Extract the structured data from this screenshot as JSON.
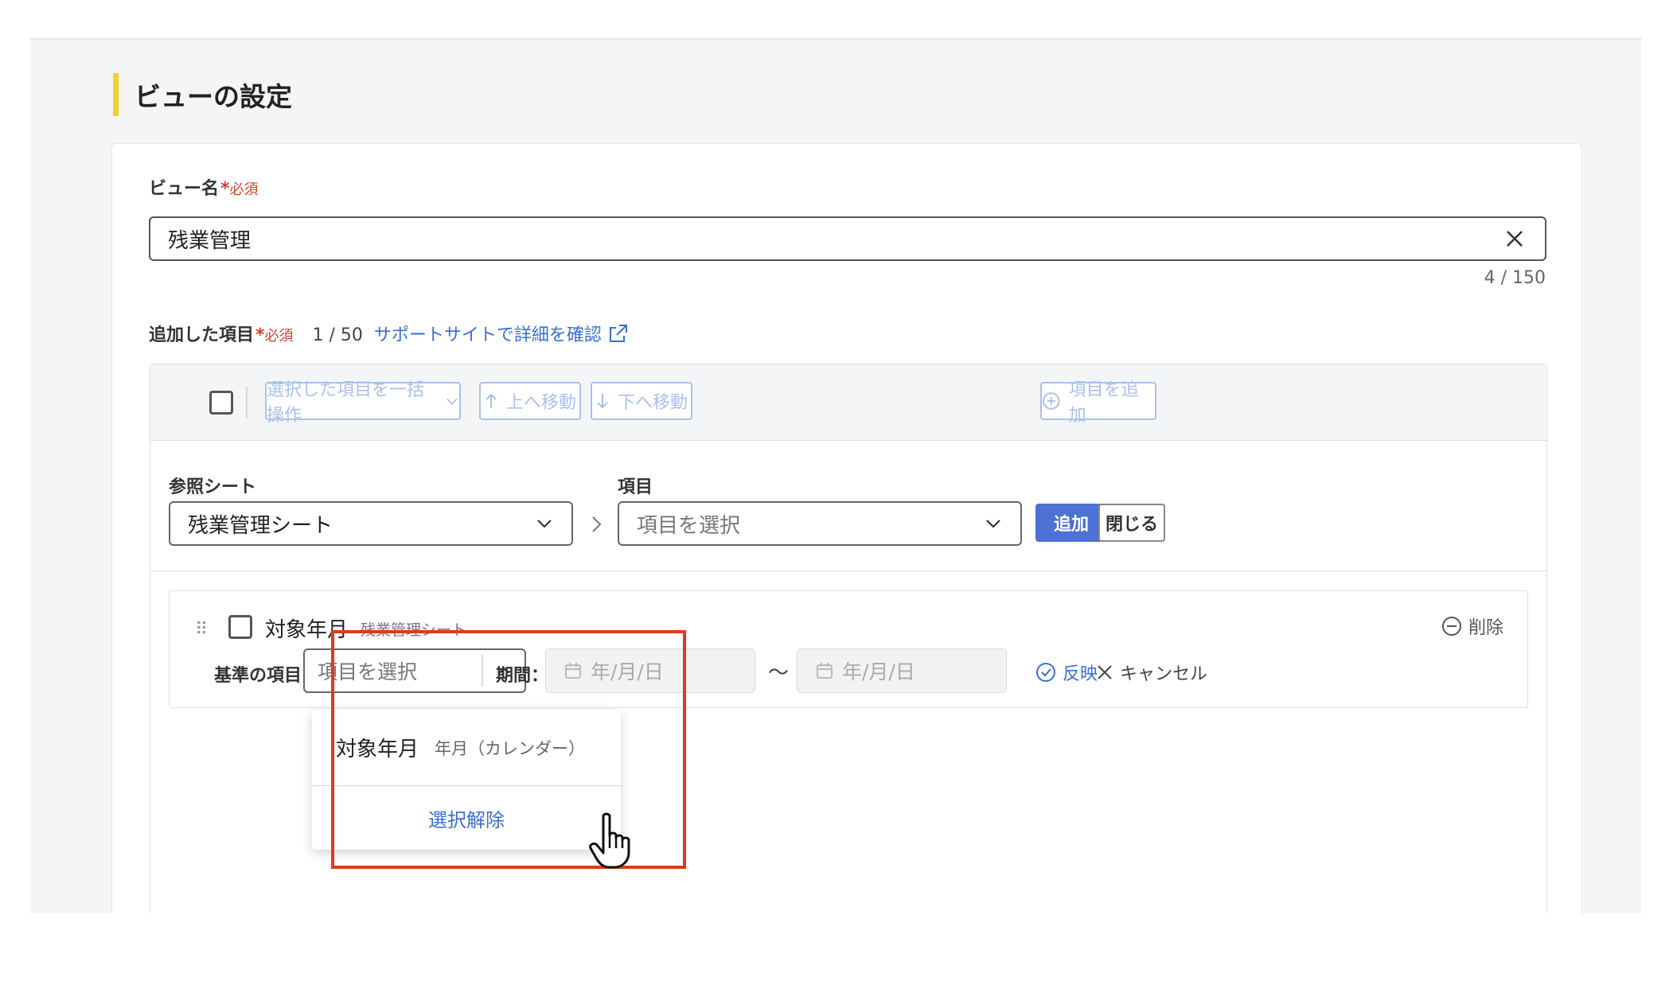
{
  "section": {
    "title": "ビューの設定"
  },
  "view_name": {
    "label": "ビュー名",
    "required_mark": "*",
    "required_text": "必須",
    "value": "残業管理",
    "counter": "4 / 150"
  },
  "items": {
    "label": "追加した項目",
    "required_mark": "*",
    "required_text": "必須",
    "count": "1 / 50",
    "support_link": "サポートサイトで詳細を確認"
  },
  "toolbar": {
    "bulk_label": "選択した項目を一括操作",
    "move_up_label": "上へ移動",
    "move_down_label": "下へ移動",
    "add_item_label": "項目を追加"
  },
  "picker": {
    "sheet_label": "参照シート",
    "sheet_value": "残業管理シート",
    "item_label": "項目",
    "item_placeholder": "項目を選択",
    "add_button": "追加",
    "close_button": "閉じる"
  },
  "item_card": {
    "drag_handle": "⠿",
    "name": "対象年月",
    "sheet": "残業管理シート",
    "delete_label": "削除",
    "base_label": "基準の項目：",
    "base_placeholder": "項目を選択",
    "period_label": "期間：",
    "date_placeholder_from": "年/月/日",
    "date_placeholder_to": "年/月/日",
    "tilde": "〜",
    "apply_label": "反映",
    "cancel_label": "キャンセル"
  },
  "dropdown": {
    "option_name": "対象年月",
    "option_type": "年月（カレンダー）",
    "clear_label": "選択解除"
  },
  "colors": {
    "accent_bar": "#f2d12c",
    "primary": "#4d72d6",
    "link": "#3a6fd4",
    "required": "#d0432f",
    "highlight": "#e0391f"
  }
}
